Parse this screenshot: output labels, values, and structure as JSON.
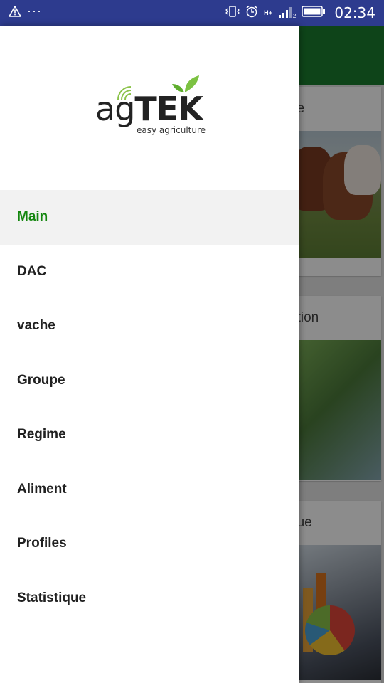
{
  "status_bar": {
    "time": "02:34",
    "left_icons": [
      "warning-icon",
      "more-dots-icon"
    ],
    "right_icons": [
      "vibrate-icon",
      "alarm-icon",
      "network-h-plus-icon",
      "signal-icon",
      "battery-icon"
    ],
    "network_label": "H+",
    "sim_index": "2"
  },
  "background_app": {
    "toolbar_color": "#1b7d2e",
    "cards": [
      {
        "title_fragment": "pe",
        "image": "cows-photo"
      },
      {
        "title_fragment": "ation",
        "image": "grass-trays-photo"
      },
      {
        "title_fragment": "que",
        "image": "statistics-chart-photo"
      }
    ]
  },
  "drawer": {
    "logo": {
      "word_light": "ag",
      "word_bold": "TEK",
      "tagline": "easy agriculture"
    },
    "menu": [
      {
        "label": "Main",
        "active": true
      },
      {
        "label": "DAC",
        "active": false
      },
      {
        "label": "vache",
        "active": false
      },
      {
        "label": "Groupe",
        "active": false
      },
      {
        "label": "Regime",
        "active": false
      },
      {
        "label": "Aliment",
        "active": false
      },
      {
        "label": "Profiles",
        "active": false
      },
      {
        "label": "Statistique",
        "active": false
      }
    ],
    "accent_color": "#13860e"
  }
}
